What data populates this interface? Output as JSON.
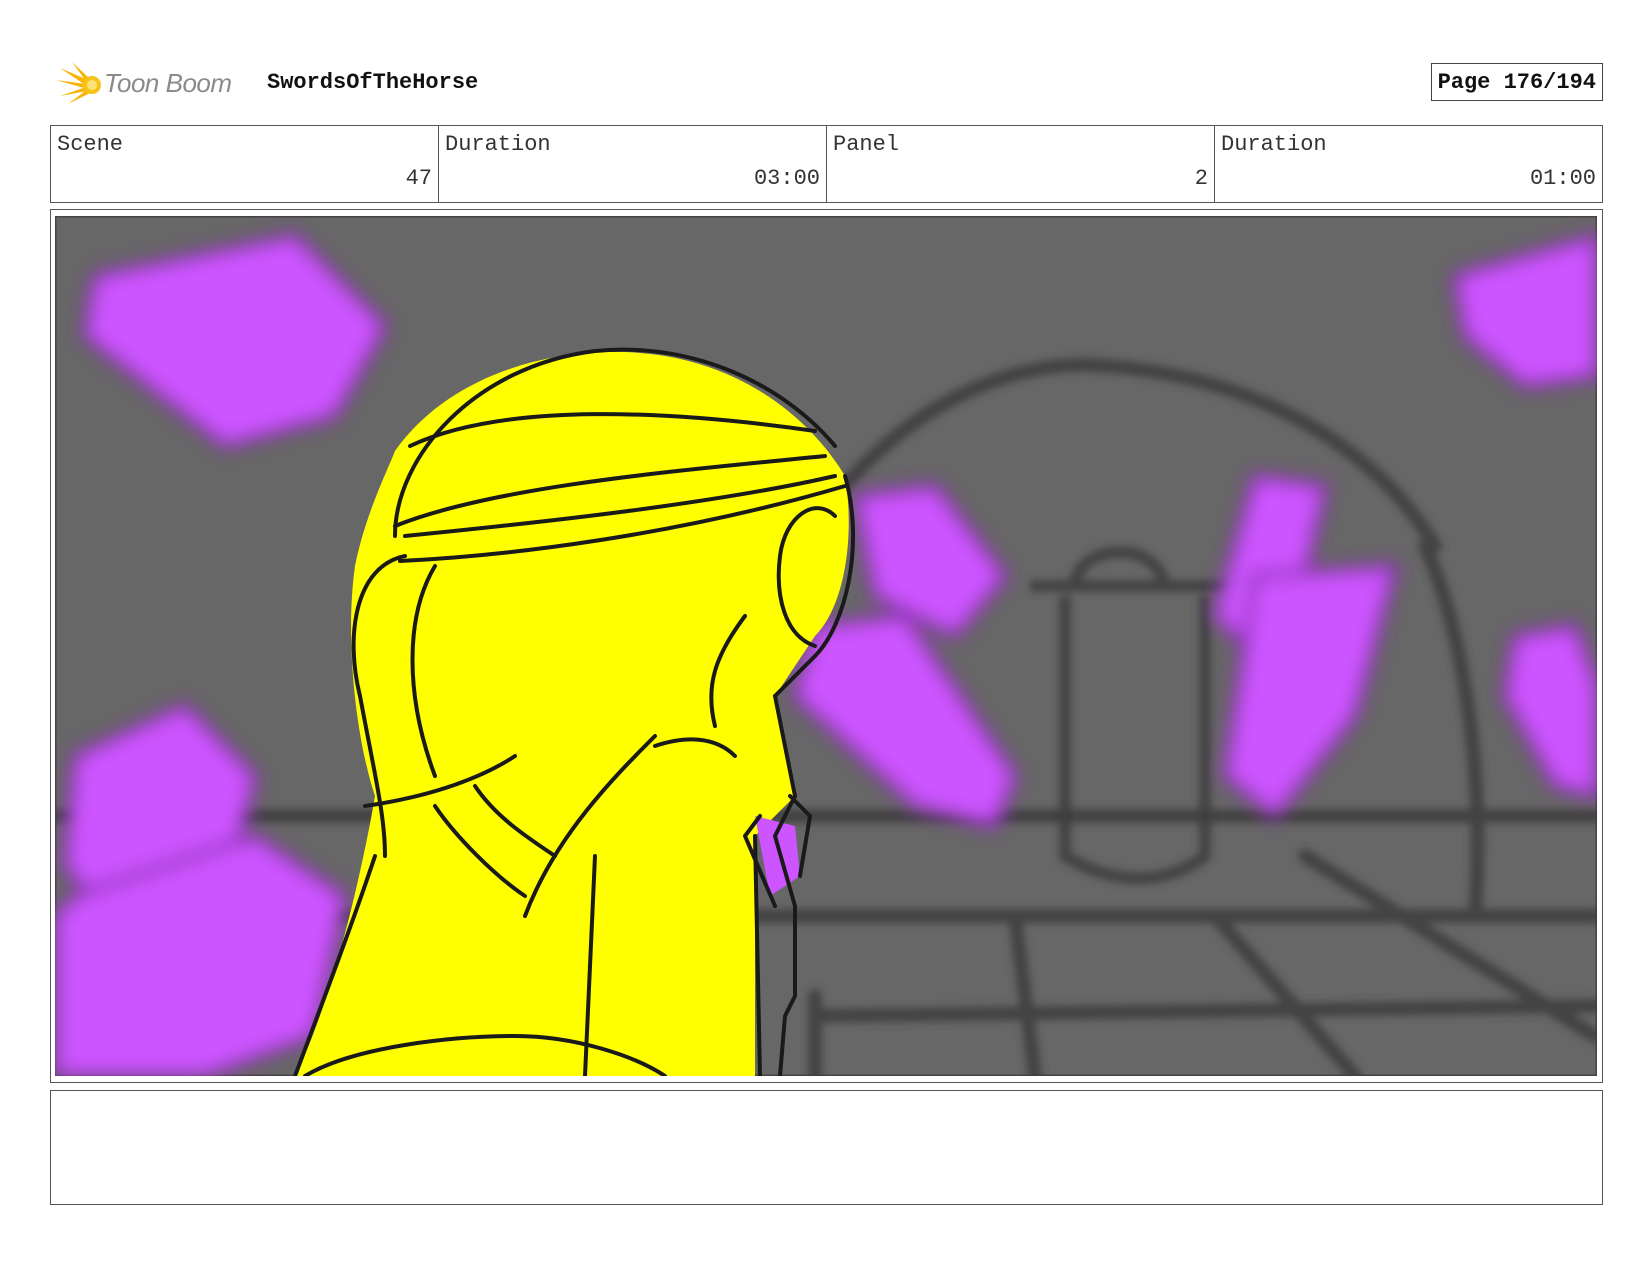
{
  "header": {
    "logo_text": "Toon Boom",
    "project_title": "SwordsOfTheHorse",
    "page_label": "Page 176/194"
  },
  "info": {
    "scene_label": "Scene",
    "scene_value": "47",
    "scene_duration_label": "Duration",
    "scene_duration_value": "03:00",
    "panel_label": "Panel",
    "panel_value": "2",
    "panel_duration_label": "Duration",
    "panel_duration_value": "01:00"
  },
  "colors": {
    "background_gray": "#676767",
    "character_yellow": "#ffff00",
    "crystal_purple": "#cc55ff",
    "line_black": "#1a1a1a",
    "logo_yellow": "#f7b500"
  },
  "notes": ""
}
